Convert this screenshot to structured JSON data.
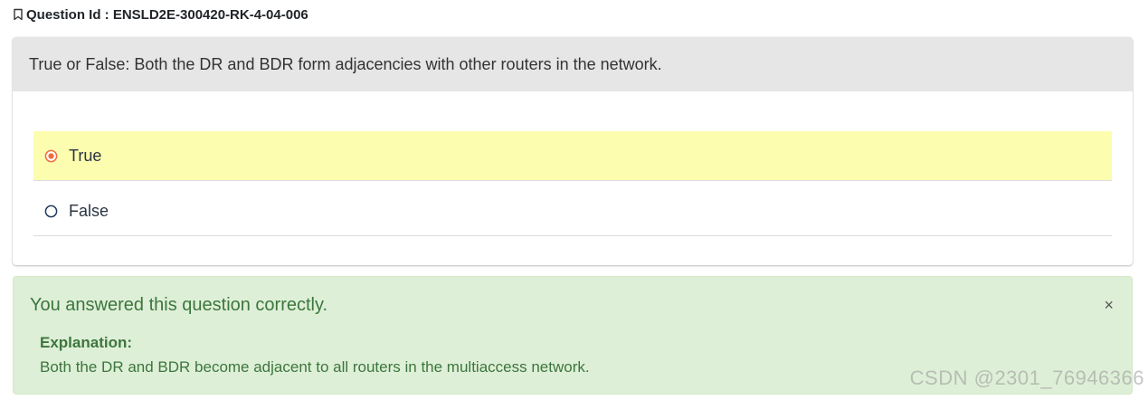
{
  "question": {
    "id_label": "Question Id : ENSLD2E-300420-RK-4-04-006",
    "prompt": "True or False: Both the DR and BDR form adjacencies with other routers in the network.",
    "options": [
      {
        "label": "True",
        "selected": true
      },
      {
        "label": "False",
        "selected": false
      }
    ]
  },
  "feedback": {
    "message": "You answered this question correctly.",
    "close_glyph": "×",
    "explanation_heading": "Explanation:",
    "explanation_text": "Both the DR and BDR become adjacent to all routers in the multiaccess network."
  },
  "watermark": "CSDN @2301_76946366",
  "colors": {
    "selected_bg": "#fdfdb0",
    "radio_selected": "#f26b3a",
    "radio_unselected": "#1f3a5f",
    "success_bg": "#deefd7",
    "success_text": "#3c763d",
    "header_bg": "#e6e6e6"
  },
  "icons": {
    "question_id": "bookmark-icon",
    "selected_option": "radio-checked-icon",
    "unselected_option": "radio-unchecked-icon",
    "dismiss": "close-icon"
  }
}
